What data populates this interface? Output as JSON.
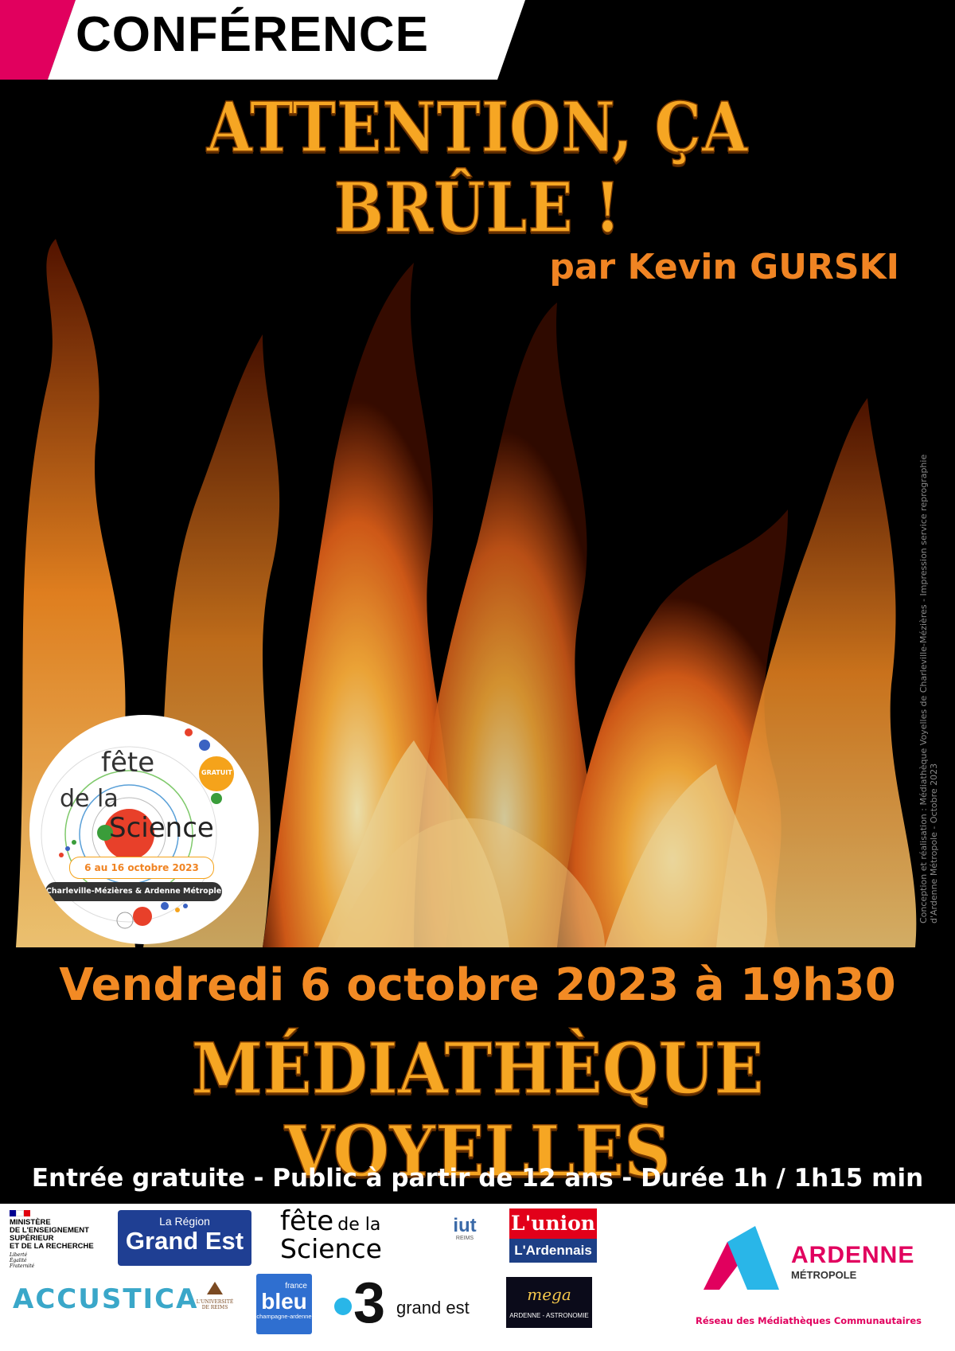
{
  "header": {
    "label": "CONFÉRENCE"
  },
  "title": "ATTENTION, ÇA BRÛLE !",
  "byline": "par Kevin GURSKI",
  "credit": "Conception et réalisation : Médiathèque Voyelles de Charleville-Mézières - Impression service reprographie d'Ardenne Métropole - Octobre 2023",
  "badge": {
    "line1": "fête",
    "line2": "de la",
    "line3": "Science",
    "free": "GRATUIT",
    "dates": "6 au 16 octobre 2023",
    "place": "Charleville-Mézières & Ardenne Métrople"
  },
  "event": {
    "date": "Vendredi 6 octobre 2023 à 19h30",
    "venue": "MÉDIATHÈQUE VOYELLES",
    "info": "Entrée gratuite - Public à partir de 12 ans - Durée 1h / 1h15 min"
  },
  "sponsors": {
    "ministere": [
      "MINISTÈRE",
      "DE L'ENSEIGNEMENT",
      "SUPÉRIEUR",
      "ET DE LA RECHERCHE"
    ],
    "ministere_motto": [
      "Liberté",
      "Égalité",
      "Fraternité"
    ],
    "region_small": "La Région",
    "region_big": "Grand Est",
    "fete1": "fête",
    "fete2": "de la",
    "fete3": "Science",
    "iut": "iut",
    "iut_sub": "REIMS",
    "union1": "L'union",
    "union2": "L'Ardennais",
    "accustica": "ACCUSTICA",
    "urca": "L'UNIVERSITÉ DE REIMS",
    "bleu_small": "france",
    "bleu_big": "bleu",
    "bleu_sub": "champagne-ardenne",
    "f3_num": "3",
    "f3_text": "grand est",
    "omega": "mega",
    "omega_sub": "ARDENNE - ASTRONOMIE",
    "ardenne1": "ARDENNE",
    "ardenne2": "MÉTROPOLE",
    "reseau": "Réseau des Médiathèques Communautaires"
  },
  "colors": {
    "accent": "#e1005e",
    "flame": "#f6a623",
    "orange": "#f28a24",
    "cyan": "#29b6e8"
  }
}
